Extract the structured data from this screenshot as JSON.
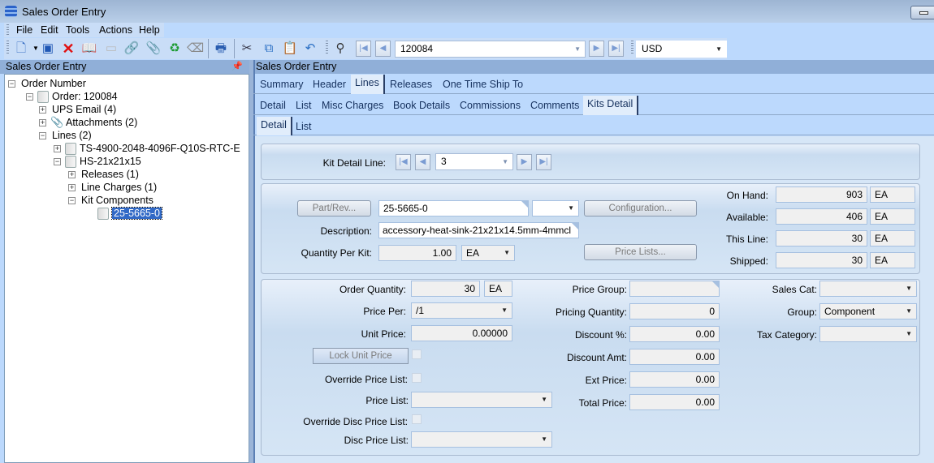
{
  "window": {
    "title": "Sales Order Entry"
  },
  "menu": [
    "File",
    "Edit",
    "Tools",
    "Actions",
    "Help"
  ],
  "toolbar": {
    "icons": [
      "new-document-icon",
      "save-icon",
      "delete-icon",
      "open-book-icon",
      "note-icon",
      "link-icon",
      "attachment-icon",
      "refresh-icon",
      "eraser-icon",
      "print-icon",
      "cut-icon",
      "copy-icon",
      "paste-icon",
      "undo-icon",
      "binoculars-icon"
    ],
    "order_number": "120084",
    "currency": "USD"
  },
  "left_panel": {
    "title": "Sales Order Entry",
    "pin": "pin-icon",
    "tree": [
      {
        "label": "Order Number",
        "level": 0,
        "toggle": "-"
      },
      {
        "label": "Order: 120084",
        "level": 1,
        "toggle": "-"
      },
      {
        "label": "UPS Email (4)",
        "level": 2,
        "toggle": "+"
      },
      {
        "label": "Attachments (2)",
        "level": 2,
        "toggle": "+"
      },
      {
        "label": "Lines (2)",
        "level": 2,
        "toggle": "-"
      },
      {
        "label": "TS-4900-2048-4096F-Q10S-RTC-E",
        "level": 3,
        "toggle": "+"
      },
      {
        "label": "HS-21x21x15",
        "level": 3,
        "toggle": "-"
      },
      {
        "label": "Releases (1)",
        "level": 4,
        "toggle": "+"
      },
      {
        "label": "Line Charges (1)",
        "level": 4,
        "toggle": "+"
      },
      {
        "label": "Kit Components",
        "level": 4,
        "toggle": "-"
      },
      {
        "label": "25-5665-0",
        "level": 5,
        "toggle": "",
        "selected": true
      }
    ]
  },
  "right_panel": {
    "title": "Sales Order Entry",
    "tabs1": [
      "Summary",
      "Header",
      "Lines",
      "Releases",
      "One Time Ship To"
    ],
    "tabs2": [
      "Detail",
      "List",
      "Misc Charges",
      "Book Details",
      "Commissions",
      "Comments",
      "Kits Detail"
    ],
    "tabs3": [
      "Detail",
      "List"
    ]
  },
  "kit": {
    "line_label": "Kit Detail Line:",
    "line_value": "3"
  },
  "part": {
    "part_rev_button": "Part/Rev...",
    "part_value": "25-5665-0",
    "rev_value": "",
    "configuration_button": "Configuration...",
    "description_label": "Description:",
    "description_value": "accessory-heat-sink-21x21x14.5mm-4mmcl",
    "qty_per_kit_label": "Quantity Per Kit:",
    "qty_per_kit_value": "1.00",
    "qty_uom": "EA",
    "price_lists_button": "Price Lists...",
    "stock": [
      {
        "label": "On Hand:",
        "value": "903",
        "uom": "EA"
      },
      {
        "label": "Available:",
        "value": "406",
        "uom": "EA"
      },
      {
        "label": "This Line:",
        "value": "30",
        "uom": "EA"
      },
      {
        "label": "Shipped:",
        "value": "30",
        "uom": "EA"
      }
    ]
  },
  "pricing": {
    "order_qty_label": "Order Quantity:",
    "order_qty": "30",
    "order_uom": "EA",
    "price_per_label": "Price Per:",
    "price_per": "/1",
    "unit_price_label": "Unit Price:",
    "unit_price": "0.00000",
    "lock_unit_price_button": "Lock Unit Price",
    "override_price_list_label": "Override Price List:",
    "price_list_label": "Price List:",
    "price_list": "",
    "override_disc_label": "Override Disc Price List:",
    "disc_price_list_label": "Disc Price List:",
    "disc_price_list": "",
    "mid": [
      {
        "label": "Price Group:",
        "value": ""
      },
      {
        "label": "Pricing Quantity:",
        "value": "0"
      },
      {
        "label": "Discount %:",
        "value": "0.00"
      },
      {
        "label": "Discount Amt:",
        "value": "0.00"
      },
      {
        "label": "Ext Price:",
        "value": "0.00"
      },
      {
        "label": "Total Price:",
        "value": "0.00"
      }
    ],
    "right": [
      {
        "label": "Sales Cat:",
        "value": ""
      },
      {
        "label": "Group:",
        "value": "Component"
      },
      {
        "label": "Tax Category:",
        "value": ""
      }
    ]
  }
}
